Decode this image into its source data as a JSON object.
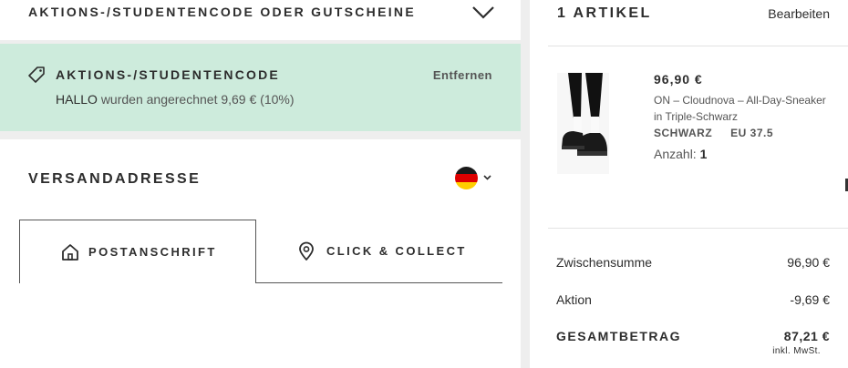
{
  "promo_header": {
    "title": "AKTIONS-/STUDENTENCODE ODER GUTSCHEINE"
  },
  "promo_applied": {
    "title": "AKTIONS-/STUDENTENCODE",
    "remove_label": "Entfernen",
    "code": "HALLO",
    "text": "wurden angerechnet 9,69 € (10%)"
  },
  "shipping": {
    "title": "VERSANDADRESSE",
    "tabs": [
      {
        "label": "POSTANSCHRIFT",
        "icon": "home-icon",
        "active": true
      },
      {
        "label": "CLICK & COLLECT",
        "icon": "location-pin-icon",
        "active": false
      }
    ],
    "country_flag": "germany-flag-icon"
  },
  "cart": {
    "count_label": "1 ARTIKEL",
    "edit_label": "Bearbeiten",
    "item": {
      "price": "96,90 €",
      "name": "ON – Cloudnova – All-Day-Sneaker in Triple-Schwarz",
      "color": "SCHWARZ",
      "size": "EU 37.5",
      "qty_label": "Anzahl:",
      "qty": "1"
    },
    "summary": {
      "subtotal_label": "Zwischensumme",
      "subtotal": "96,90 €",
      "discount_label": "Aktion",
      "discount": "-9,69 €",
      "total_label": "GESAMTBETRAG",
      "total": "87,21 €",
      "vat_note": "inkl. MwSt."
    }
  },
  "colors": {
    "promo_bg": "#cdebdc",
    "text": "#2d2d2d",
    "page_bg": "#eeeeee"
  }
}
